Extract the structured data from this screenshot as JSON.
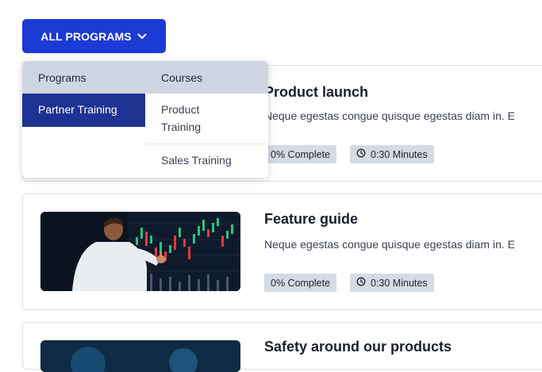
{
  "header": {
    "programs_button_label": "ALL PROGRAMS"
  },
  "dropdown": {
    "col_programs": "Programs",
    "col_courses": "Courses",
    "programs": [
      "Partner Training"
    ],
    "courses": [
      "Product Training",
      "Sales Training"
    ]
  },
  "cards": [
    {
      "title": "Product launch",
      "description": "Neque egestas congue quisque egestas diam in. E",
      "progress": "0% Complete",
      "duration": "0:30 Minutes"
    },
    {
      "title": "Feature guide",
      "description": "Neque egestas congue quisque egestas diam in. E",
      "progress": "0% Complete",
      "duration": "0:30 Minutes"
    },
    {
      "title": "Safety around our products"
    }
  ],
  "icons": {
    "chevron": "chevron-down-icon",
    "clock": "clock-icon"
  },
  "colors": {
    "accent": "#1c3bd4",
    "dropdown_active": "#1e3391",
    "chip_bg": "#d5dbe5"
  }
}
